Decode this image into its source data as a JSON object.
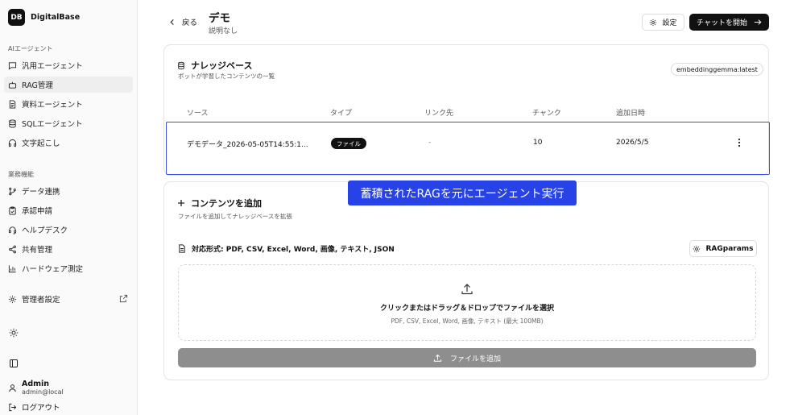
{
  "sidebar": {
    "logo": "DB",
    "brand": "DigitalBase",
    "section_ai": "AIエージェント",
    "ai_items": [
      {
        "label": "汎用エージェント",
        "icon": "chat-icon"
      },
      {
        "label": "RAG管理",
        "icon": "bot-icon"
      },
      {
        "label": "資料エージェント",
        "icon": "document-icon"
      },
      {
        "label": "SQLエージェント",
        "icon": "database-icon"
      },
      {
        "label": "文字起こし",
        "icon": "headphones-icon"
      }
    ],
    "section_business": "業務機能",
    "business_items": [
      {
        "label": "データ連携",
        "icon": "git-branch-icon"
      },
      {
        "label": "承認申請",
        "icon": "clipboard-check-icon"
      },
      {
        "label": "ヘルプデスク",
        "icon": "headset-icon"
      },
      {
        "label": "共有管理",
        "icon": "share-icon"
      },
      {
        "label": "ハードウェア測定",
        "icon": "bar-chart-icon"
      }
    ],
    "admin_label": "管理者設定",
    "user_name": "Admin",
    "user_email": "admin@local",
    "logout": "ログアウト"
  },
  "header": {
    "back": "戻る",
    "title": "デモ",
    "subtitle": "説明なし",
    "settings": "設定",
    "start_chat": "チャットを開始"
  },
  "knowledge": {
    "title": "ナレッジベース",
    "description": "ボットが学習したコンテンツの一覧",
    "model": "embeddinggemma:latest",
    "columns": [
      "ソース",
      "タイプ",
      "リンク先",
      "チャンク",
      "追加日時"
    ],
    "rows": [
      {
        "source": "デモデータ_2026-05-05T14:55:1...",
        "type": "ファイル",
        "link": "-",
        "chunks": "10",
        "added": "2026/5/5"
      }
    ]
  },
  "add_content": {
    "title": "コンテンツを追加",
    "description": "ファイルを追加してナレッジベースを拡張",
    "formats": "対応形式: PDF, CSV, Excel, Word, 画像, テキスト, JSON",
    "params_button": "RAGparams",
    "drop_title": "クリックまたはドラッグ＆ドロップでファイルを選択",
    "drop_sub": "PDF, CSV, Excel, Word, 画像, テキスト (最大 100MB)",
    "add_button": "ファイルを追加"
  },
  "banner": "蓄積されたRAGを元にエージェント実行"
}
